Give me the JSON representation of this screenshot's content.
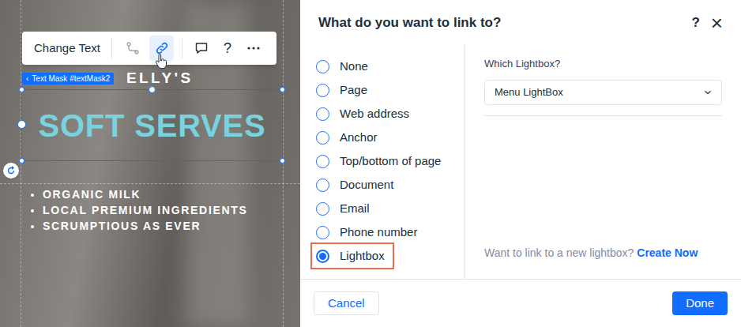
{
  "canvas": {
    "toolbar": {
      "change_text": "Change Text",
      "help": "?",
      "link_selected": true
    },
    "badge": {
      "chevron": "‹",
      "label": "Text Mask #textMask2"
    },
    "heading": "ELLY'S",
    "mask_text": "SOFT SERVES",
    "bullets": [
      "ORGANIC MILK",
      "LOCAL PREMIUM INGREDIENTS",
      "SCRUMPTIOUS AS EVER"
    ]
  },
  "dialog": {
    "title": "What do you want to link to?",
    "help": "?",
    "close": "×",
    "options": [
      {
        "label": "None",
        "selected": false
      },
      {
        "label": "Page",
        "selected": false
      },
      {
        "label": "Web address",
        "selected": false
      },
      {
        "label": "Anchor",
        "selected": false
      },
      {
        "label": "Top/bottom of page",
        "selected": false
      },
      {
        "label": "Document",
        "selected": false
      },
      {
        "label": "Email",
        "selected": false
      },
      {
        "label": "Phone number",
        "selected": false
      },
      {
        "label": "Lightbox",
        "selected": true
      }
    ],
    "lightbox": {
      "label": "Which Lightbox?",
      "value": "Menu LightBox",
      "prompt": "Want to link to a new lightbox?",
      "create_link": "Create Now"
    },
    "buttons": [
      {
        "label": "Cancel",
        "kind": "secondary"
      },
      {
        "label": "Done",
        "kind": "primary"
      }
    ]
  }
}
